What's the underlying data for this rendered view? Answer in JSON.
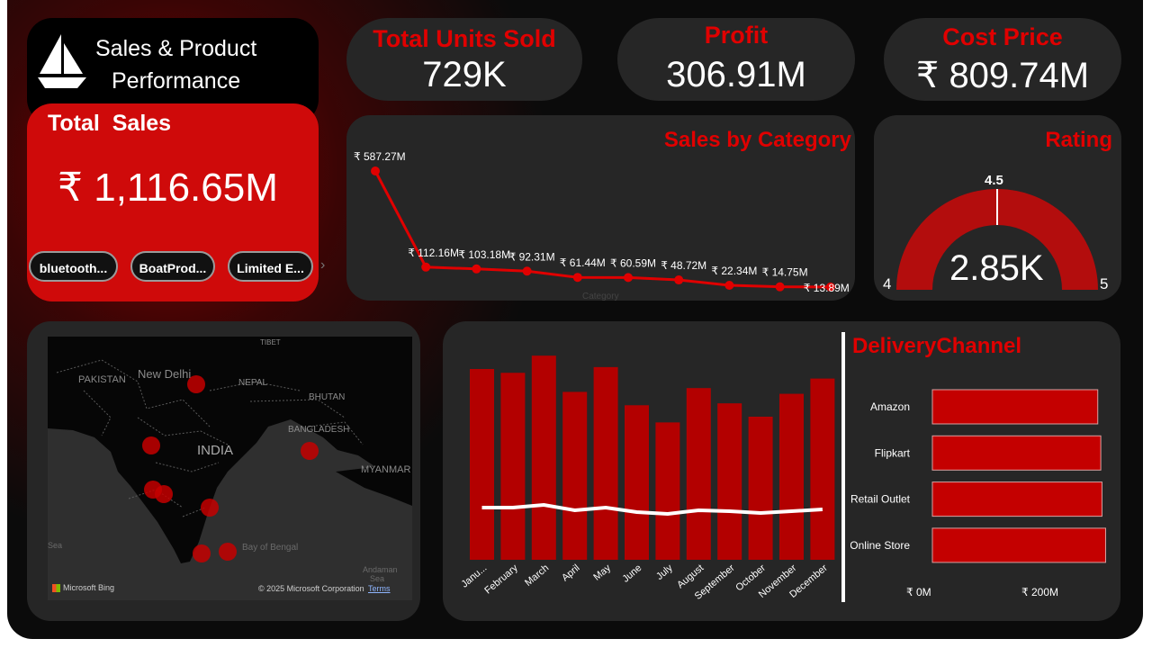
{
  "brand": {
    "title_line1": "Sales & Product",
    "title_line2": "Performance",
    "logo_icon": "sailboat-icon"
  },
  "total_sales": {
    "label": "Total  Sales",
    "value": "₹ 1,116.65M"
  },
  "chips": [
    "bluetooth...",
    "BoatProd...",
    "Limited E..."
  ],
  "kpis": {
    "units": {
      "label": "Total Units Sold",
      "value": "729K"
    },
    "profit": {
      "label": "Profit",
      "value": "306.91M"
    },
    "cost": {
      "label": "Cost Price",
      "value": "₹ 809.74M"
    }
  },
  "sales_by_category": {
    "title": "Sales by Category",
    "axis_label": "Category",
    "chart_data": {
      "type": "line",
      "values": [
        587.27,
        112.16,
        103.18,
        92.31,
        61.44,
        60.59,
        48.72,
        22.34,
        14.75,
        13.89
      ],
      "labels": [
        "₹ 587.27M",
        "₹ 112.16M",
        "₹ 103.18M",
        "₹ 92.31M",
        "₹ 61.44M",
        "₹ 60.59M",
        "₹ 48.72M",
        "₹ 22.34M",
        "₹ 14.75M",
        "₹ 13.89M"
      ],
      "color": "#e00000"
    }
  },
  "rating": {
    "title": "Rating",
    "value": "2.85K",
    "min": "4",
    "max": "5",
    "target": "4.5",
    "chart_data": {
      "type": "gauge",
      "min": 4,
      "max": 5,
      "value": 5,
      "target": 4.5
    }
  },
  "map": {
    "labels": {
      "pakistan": "PAKISTAN",
      "new_delhi": "New Delhi",
      "nepal": "NEPAL",
      "tibet": "TIBET",
      "bhutan": "BHUTAN",
      "india": "INDIA",
      "bangladesh": "BANGLADESH",
      "myanmar": "MYANMAR",
      "sea": "Sea",
      "bay": "Bay of Bengal",
      "andaman_1": "Andaman",
      "andaman_2": "Sea"
    },
    "attribution": "Microsoft Bing",
    "copyright": "© 2025 Microsoft Corporation",
    "terms": "Terms"
  },
  "monthly": {
    "chart_data": {
      "type": "bar",
      "categories": [
        "Janu...",
        "February",
        "March",
        "April",
        "May",
        "June",
        "July",
        "August",
        "September",
        "October",
        "November",
        "December"
      ],
      "bar_values": [
        100,
        98,
        107,
        88,
        101,
        81,
        72,
        90,
        82,
        75,
        87,
        95
      ],
      "line_values": [
        15,
        15,
        18,
        12,
        15,
        10,
        8,
        12,
        11,
        9,
        11,
        13
      ],
      "bar_color": "#b30000",
      "line_color": "#ffffff"
    }
  },
  "delivery": {
    "title": "DeliveryChannel",
    "chart_data": {
      "type": "bar",
      "orientation": "horizontal",
      "categories": [
        "Amazon",
        "Flipkart",
        "Retail Outlet",
        "Online Store"
      ],
      "values": [
        273,
        278,
        280,
        286
      ],
      "unit": "₹M",
      "ticks": [
        "₹ 0M",
        "₹ 200M"
      ],
      "bar_color": "#c40000"
    }
  }
}
